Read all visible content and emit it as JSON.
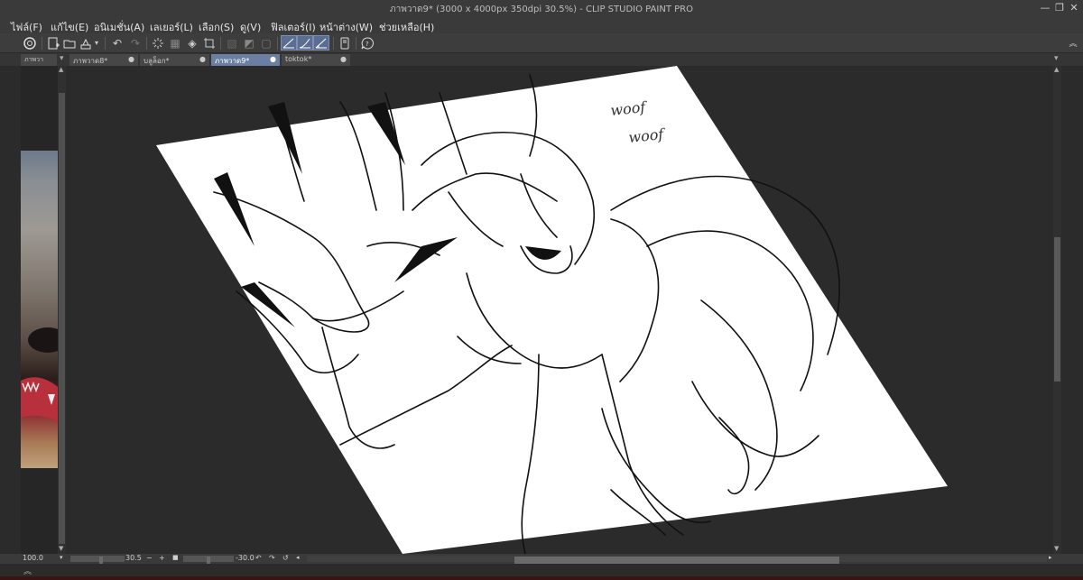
{
  "window": {
    "title": "ภาพวาด9* (3000 x 4000px 350dpi 30.5%)  - CLIP STUDIO PAINT PRO",
    "minimize": "—",
    "maximize": "❐",
    "close": "✕"
  },
  "menu": [
    "ไฟล์(F)",
    "แก้ไข(E)",
    "อนิเมชั่น(A)",
    "เลเยอร์(L)",
    "เลือก(S)",
    "ดู(V)",
    "ฟิลเตอร์(I)",
    "หน้าต่าง(W)",
    "ช่วยเหลือ(H)"
  ],
  "tabs": [
    {
      "label": "ภาพวา",
      "modified": false
    },
    {
      "label": "ภาพวาด8*",
      "modified": true
    },
    {
      "label": "บลูล็อก*",
      "modified": true
    },
    {
      "label": "ภาพวาด9*",
      "modified": true,
      "active": true
    },
    {
      "label": "toktok*",
      "modified": true
    }
  ],
  "canvas": {
    "annotation_line1": "woof",
    "annotation_line2": "woof"
  },
  "status": {
    "left_zoom": "100.0",
    "zoom": "30.5",
    "rotation": "-30.0"
  },
  "colors": {
    "accent": "#6b7fa3",
    "background": "#2b2b2b",
    "paper": "#ffffff"
  }
}
